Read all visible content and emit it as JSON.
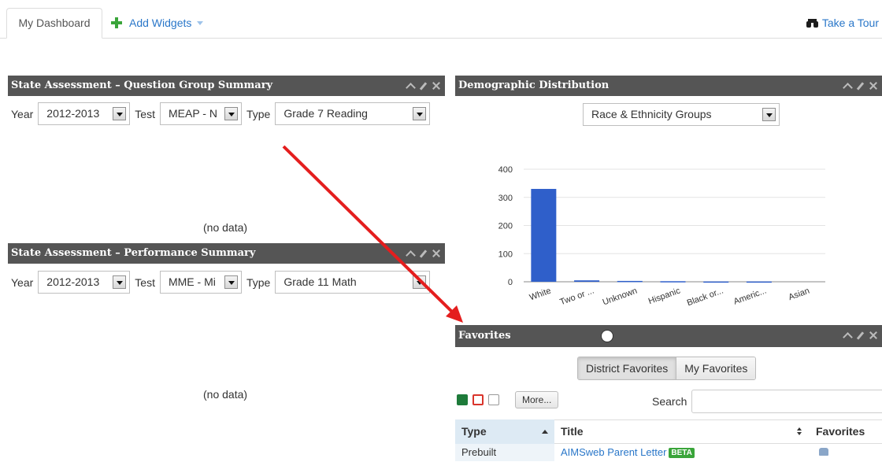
{
  "tabs": {
    "dashboard": "My Dashboard",
    "add_widgets": "Add Widgets",
    "take_tour": "Take a Tour"
  },
  "widgets": {
    "qgs": {
      "title": "State Assessment – Question Group Summary",
      "year_label": "Year",
      "year_value": "2012-2013",
      "test_label": "Test",
      "test_value": "MEAP - N",
      "type_label": "Type",
      "type_value": "Grade 7 Reading",
      "no_data": "(no data)"
    },
    "perf": {
      "title": "State Assessment – Performance Summary",
      "year_label": "Year",
      "year_value": "2012-2013",
      "test_label": "Test",
      "test_value": "MME - Mi",
      "type_label": "Type",
      "type_value": "Grade 11 Math",
      "no_data": "(no data)"
    },
    "demo": {
      "title": "Demographic Distribution",
      "group_value": "Race & Ethnicity Groups"
    },
    "fav": {
      "title": "Favorites",
      "district_btn": "District Favorites",
      "my_btn": "My Favorites",
      "more_btn": "More...",
      "search_label": "Search",
      "col_type": "Type",
      "col_title": "Title",
      "col_favorites": "Favorites",
      "row_type": "Prebuilt",
      "row_title": "AIMSweb Parent Letter",
      "row_badge": "BETA"
    }
  },
  "chart_data": {
    "type": "bar",
    "categories": [
      "White",
      "Two or ...",
      "Unknown",
      "Hispanic",
      "Black or...",
      "Americ...",
      "Asian"
    ],
    "values": [
      330,
      5,
      3,
      2,
      1,
      1,
      0
    ],
    "ylim": [
      0,
      400
    ],
    "yticks": [
      0,
      100,
      200,
      300,
      400
    ],
    "bar_color": "#2f5fca",
    "grid": true
  },
  "colors": {
    "accent": "#2a77c9",
    "header": "#555555",
    "arrow": "#e41e1e",
    "add_icon": "#3aa53a"
  },
  "icons": [
    "plus-icon",
    "binoculars-icon",
    "chevron-up-icon",
    "pencil-icon",
    "close-icon",
    "move-icon",
    "excel-icon",
    "pdf-icon",
    "document-icon",
    "sort-icon",
    "person-icon"
  ]
}
